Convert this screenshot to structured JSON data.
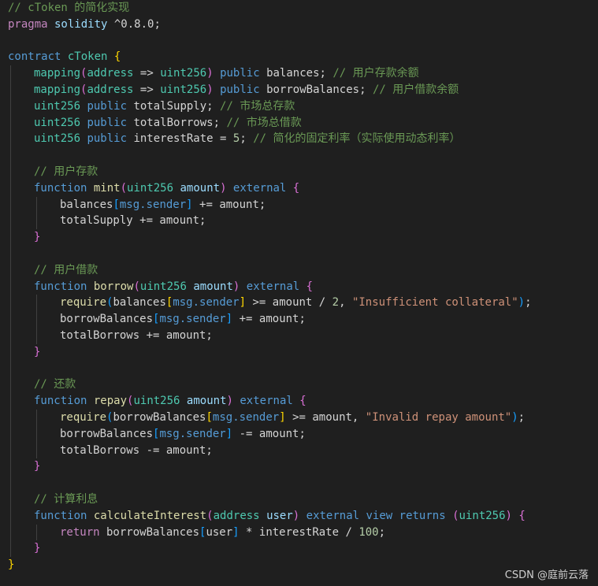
{
  "colors": {
    "background": "#1f1f1f",
    "comment": "#6a9955",
    "keyword": "#569cd6",
    "type": "#4ec9b0",
    "function": "#dcdcaa",
    "parameter": "#9cdcfe",
    "string": "#ce9178",
    "number": "#b5cea8",
    "control": "#c586c0",
    "bracket_level1": "#ffd700",
    "bracket_level2": "#da70d6",
    "bracket_level3": "#179fff"
  },
  "watermark": "CSDN @庭前云落",
  "lines": [
    {
      "indent": 0,
      "tokens": [
        {
          "t": "// cToken 的简化实现",
          "c": "t-comment"
        }
      ]
    },
    {
      "indent": 0,
      "tokens": [
        {
          "t": "pragma",
          "c": "t-ctrl"
        },
        {
          "t": " solidity ",
          "c": "t-param"
        },
        {
          "t": "^0.8.0;",
          "c": "t-plain"
        }
      ]
    },
    {
      "indent": 0,
      "tokens": []
    },
    {
      "indent": 0,
      "tokens": [
        {
          "t": "contract",
          "c": "t-kw"
        },
        {
          "t": " ",
          "c": "t-plain"
        },
        {
          "t": "cToken",
          "c": "t-type"
        },
        {
          "t": " ",
          "c": "t-plain"
        },
        {
          "t": "{",
          "c": "b1"
        }
      ]
    },
    {
      "indent": 1,
      "tokens": [
        {
          "t": "mapping",
          "c": "t-type"
        },
        {
          "t": "(",
          "c": "b2"
        },
        {
          "t": "address",
          "c": "t-type"
        },
        {
          "t": " => ",
          "c": "t-plain"
        },
        {
          "t": "uint256",
          "c": "t-type"
        },
        {
          "t": ")",
          "c": "b2"
        },
        {
          "t": " public ",
          "c": "t-kw"
        },
        {
          "t": "balances; ",
          "c": "t-plain"
        },
        {
          "t": "// 用户存款余额",
          "c": "t-comment"
        }
      ]
    },
    {
      "indent": 1,
      "tokens": [
        {
          "t": "mapping",
          "c": "t-type"
        },
        {
          "t": "(",
          "c": "b2"
        },
        {
          "t": "address",
          "c": "t-type"
        },
        {
          "t": " => ",
          "c": "t-plain"
        },
        {
          "t": "uint256",
          "c": "t-type"
        },
        {
          "t": ")",
          "c": "b2"
        },
        {
          "t": " public ",
          "c": "t-kw"
        },
        {
          "t": "borrowBalances; ",
          "c": "t-plain"
        },
        {
          "t": "// 用户借款余额",
          "c": "t-comment"
        }
      ]
    },
    {
      "indent": 1,
      "tokens": [
        {
          "t": "uint256",
          "c": "t-type"
        },
        {
          "t": " public ",
          "c": "t-kw"
        },
        {
          "t": "totalSupply; ",
          "c": "t-plain"
        },
        {
          "t": "// 市场总存款",
          "c": "t-comment"
        }
      ]
    },
    {
      "indent": 1,
      "tokens": [
        {
          "t": "uint256",
          "c": "t-type"
        },
        {
          "t": " public ",
          "c": "t-kw"
        },
        {
          "t": "totalBorrows; ",
          "c": "t-plain"
        },
        {
          "t": "// 市场总借款",
          "c": "t-comment"
        }
      ]
    },
    {
      "indent": 1,
      "tokens": [
        {
          "t": "uint256",
          "c": "t-type"
        },
        {
          "t": " public ",
          "c": "t-kw"
        },
        {
          "t": "interestRate = ",
          "c": "t-plain"
        },
        {
          "t": "5",
          "c": "t-num"
        },
        {
          "t": "; ",
          "c": "t-plain"
        },
        {
          "t": "// 简化的固定利率（实际使用动态利率）",
          "c": "t-comment"
        }
      ]
    },
    {
      "indent": 1,
      "tokens": []
    },
    {
      "indent": 1,
      "tokens": [
        {
          "t": "// 用户存款",
          "c": "t-comment"
        }
      ]
    },
    {
      "indent": 1,
      "tokens": [
        {
          "t": "function",
          "c": "t-kw"
        },
        {
          "t": " ",
          "c": "t-plain"
        },
        {
          "t": "mint",
          "c": "t-func"
        },
        {
          "t": "(",
          "c": "b2"
        },
        {
          "t": "uint256",
          "c": "t-type"
        },
        {
          "t": " ",
          "c": "t-plain"
        },
        {
          "t": "amount",
          "c": "t-param"
        },
        {
          "t": ")",
          "c": "b2"
        },
        {
          "t": " external ",
          "c": "t-kw"
        },
        {
          "t": "{",
          "c": "b2"
        }
      ]
    },
    {
      "indent": 2,
      "tokens": [
        {
          "t": "balances",
          "c": "t-plain"
        },
        {
          "t": "[",
          "c": "b3"
        },
        {
          "t": "msg.sender",
          "c": "t-kw"
        },
        {
          "t": "]",
          "c": "b3"
        },
        {
          "t": " += amount;",
          "c": "t-plain"
        }
      ]
    },
    {
      "indent": 2,
      "tokens": [
        {
          "t": "totalSupply += amount;",
          "c": "t-plain"
        }
      ]
    },
    {
      "indent": 1,
      "tokens": [
        {
          "t": "}",
          "c": "b2"
        }
      ]
    },
    {
      "indent": 1,
      "tokens": []
    },
    {
      "indent": 1,
      "tokens": [
        {
          "t": "// 用户借款",
          "c": "t-comment"
        }
      ]
    },
    {
      "indent": 1,
      "tokens": [
        {
          "t": "function",
          "c": "t-kw"
        },
        {
          "t": " ",
          "c": "t-plain"
        },
        {
          "t": "borrow",
          "c": "t-func"
        },
        {
          "t": "(",
          "c": "b2"
        },
        {
          "t": "uint256",
          "c": "t-type"
        },
        {
          "t": " ",
          "c": "t-plain"
        },
        {
          "t": "amount",
          "c": "t-param"
        },
        {
          "t": ")",
          "c": "b2"
        },
        {
          "t": " external ",
          "c": "t-kw"
        },
        {
          "t": "{",
          "c": "b2"
        }
      ]
    },
    {
      "indent": 2,
      "tokens": [
        {
          "t": "require",
          "c": "t-func"
        },
        {
          "t": "(",
          "c": "b3"
        },
        {
          "t": "balances",
          "c": "t-plain"
        },
        {
          "t": "[",
          "c": "b1"
        },
        {
          "t": "msg.sender",
          "c": "t-kw"
        },
        {
          "t": "]",
          "c": "b1"
        },
        {
          "t": " >= amount / ",
          "c": "t-plain"
        },
        {
          "t": "2",
          "c": "t-num"
        },
        {
          "t": ", ",
          "c": "t-plain"
        },
        {
          "t": "\"Insufficient collateral\"",
          "c": "t-str"
        },
        {
          "t": ")",
          "c": "b3"
        },
        {
          "t": ";",
          "c": "t-plain"
        }
      ]
    },
    {
      "indent": 2,
      "tokens": [
        {
          "t": "borrowBalances",
          "c": "t-plain"
        },
        {
          "t": "[",
          "c": "b3"
        },
        {
          "t": "msg.sender",
          "c": "t-kw"
        },
        {
          "t": "]",
          "c": "b3"
        },
        {
          "t": " += amount;",
          "c": "t-plain"
        }
      ]
    },
    {
      "indent": 2,
      "tokens": [
        {
          "t": "totalBorrows += amount;",
          "c": "t-plain"
        }
      ]
    },
    {
      "indent": 1,
      "tokens": [
        {
          "t": "}",
          "c": "b2"
        }
      ]
    },
    {
      "indent": 1,
      "tokens": []
    },
    {
      "indent": 1,
      "tokens": [
        {
          "t": "// 还款",
          "c": "t-comment"
        }
      ]
    },
    {
      "indent": 1,
      "tokens": [
        {
          "t": "function",
          "c": "t-kw"
        },
        {
          "t": " ",
          "c": "t-plain"
        },
        {
          "t": "repay",
          "c": "t-func"
        },
        {
          "t": "(",
          "c": "b2"
        },
        {
          "t": "uint256",
          "c": "t-type"
        },
        {
          "t": " ",
          "c": "t-plain"
        },
        {
          "t": "amount",
          "c": "t-param"
        },
        {
          "t": ")",
          "c": "b2"
        },
        {
          "t": " external ",
          "c": "t-kw"
        },
        {
          "t": "{",
          "c": "b2"
        }
      ]
    },
    {
      "indent": 2,
      "tokens": [
        {
          "t": "require",
          "c": "t-func"
        },
        {
          "t": "(",
          "c": "b3"
        },
        {
          "t": "borrowBalances",
          "c": "t-plain"
        },
        {
          "t": "[",
          "c": "b1"
        },
        {
          "t": "msg.sender",
          "c": "t-kw"
        },
        {
          "t": "]",
          "c": "b1"
        },
        {
          "t": " >= amount, ",
          "c": "t-plain"
        },
        {
          "t": "\"Invalid repay amount\"",
          "c": "t-str"
        },
        {
          "t": ")",
          "c": "b3"
        },
        {
          "t": ";",
          "c": "t-plain"
        }
      ]
    },
    {
      "indent": 2,
      "tokens": [
        {
          "t": "borrowBalances",
          "c": "t-plain"
        },
        {
          "t": "[",
          "c": "b3"
        },
        {
          "t": "msg.sender",
          "c": "t-kw"
        },
        {
          "t": "]",
          "c": "b3"
        },
        {
          "t": " -= amount;",
          "c": "t-plain"
        }
      ]
    },
    {
      "indent": 2,
      "tokens": [
        {
          "t": "totalBorrows -= amount;",
          "c": "t-plain"
        }
      ]
    },
    {
      "indent": 1,
      "tokens": [
        {
          "t": "}",
          "c": "b2"
        }
      ]
    },
    {
      "indent": 1,
      "tokens": []
    },
    {
      "indent": 1,
      "tokens": [
        {
          "t": "// 计算利息",
          "c": "t-comment"
        }
      ]
    },
    {
      "indent": 1,
      "tokens": [
        {
          "t": "function",
          "c": "t-kw"
        },
        {
          "t": " ",
          "c": "t-plain"
        },
        {
          "t": "calculateInterest",
          "c": "t-func"
        },
        {
          "t": "(",
          "c": "b2"
        },
        {
          "t": "address",
          "c": "t-type"
        },
        {
          "t": " ",
          "c": "t-plain"
        },
        {
          "t": "user",
          "c": "t-param"
        },
        {
          "t": ")",
          "c": "b2"
        },
        {
          "t": " external view returns ",
          "c": "t-kw"
        },
        {
          "t": "(",
          "c": "b2"
        },
        {
          "t": "uint256",
          "c": "t-type"
        },
        {
          "t": ")",
          "c": "b2"
        },
        {
          "t": " ",
          "c": "t-plain"
        },
        {
          "t": "{",
          "c": "b2"
        }
      ]
    },
    {
      "indent": 2,
      "tokens": [
        {
          "t": "return",
          "c": "t-ctrl"
        },
        {
          "t": " borrowBalances",
          "c": "t-plain"
        },
        {
          "t": "[",
          "c": "b3"
        },
        {
          "t": "user",
          "c": "t-plain"
        },
        {
          "t": "]",
          "c": "b3"
        },
        {
          "t": " * interestRate / ",
          "c": "t-plain"
        },
        {
          "t": "100",
          "c": "t-num"
        },
        {
          "t": ";",
          "c": "t-plain"
        }
      ]
    },
    {
      "indent": 1,
      "tokens": [
        {
          "t": "}",
          "c": "b2"
        }
      ]
    },
    {
      "indent": 0,
      "tokens": [
        {
          "t": "}",
          "c": "b1"
        }
      ]
    }
  ]
}
